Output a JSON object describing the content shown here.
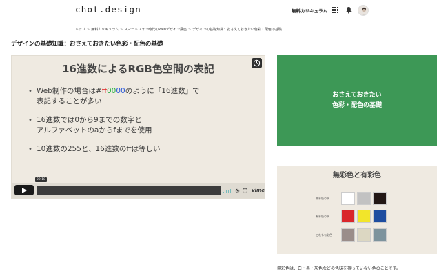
{
  "header": {
    "logo": "chot.design",
    "nav_link": "無料カリキュラム"
  },
  "breadcrumb": [
    "トップ",
    "無料カリキュラム",
    "スマートフォン時代のWebデザイン講座",
    "デザインの基礎知識：おさえておきたい色彩・配色の基礎"
  ],
  "page_title": "デザインの基礎知識：おさえておきたい色彩・配色の基礎",
  "video": {
    "slide_title": "16進数によるRGB色空間の表記",
    "bullets": [
      {
        "line1_pre": "Web制作の場合は",
        "hex_hash": "#",
        "hex_ff": "ff",
        "hex_00a": "00",
        "hex_00b": "00",
        "line1_post": "のように「16進数」で",
        "line2": "表記することが多い"
      },
      {
        "line1": "16進数では0から9までの数字と",
        "line2": "アルファベットのaからfまでを使用"
      },
      {
        "line1": "10進数の255と、16進数のffは等しい"
      }
    ],
    "time": "29:18",
    "progress": 0.0,
    "brand": "vimeo"
  },
  "green_box": {
    "line1": "おさえておきたい",
    "line2": "色彩・配色の基礎"
  },
  "color_card": {
    "title": "無彩色と有彩色",
    "rows": [
      {
        "label": "無彩色の例",
        "colors": [
          "#ffffff",
          "#c2c2c2",
          "#231815"
        ]
      },
      {
        "label": "有彩色の例",
        "colors": [
          "#d9262b",
          "#f2e52a",
          "#1e4da0"
        ]
      },
      {
        "label": "これも有彩色",
        "colors": [
          "#9a8d8a",
          "#dcd7c2",
          "#7d939d"
        ]
      }
    ]
  },
  "footnote": "無彩色は、白・黒・灰色などの色味を持っていない色のことです。",
  "colors": {
    "accent_green": "#3d9856",
    "slide_bg": "#efeae1"
  },
  "icons": [
    "grid-icon",
    "bell-icon",
    "clock-icon",
    "play-icon",
    "volume-icon",
    "settings-icon",
    "fullscreen-icon"
  ]
}
